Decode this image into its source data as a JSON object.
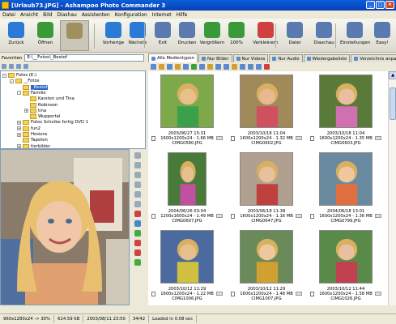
{
  "window": {
    "title": "[Urlaub73.JPG] - Ashampoo Photo Commander 3"
  },
  "menu": [
    "Datei",
    "Ansicht",
    "Bild",
    "Diashau",
    "Assistenten",
    "Konfiguration",
    "Internet",
    "Hilfe"
  ],
  "toolbar": [
    {
      "label": "Zurück",
      "icon": "back-arrow-icon",
      "color": "#2a7ad6"
    },
    {
      "label": "Öffnen",
      "icon": "open-icon",
      "color": "#3a9a3a"
    },
    {
      "label": "",
      "icon": "album-icon",
      "color": "#a09060"
    },
    {
      "label": "Vorherige",
      "icon": "prev-icon",
      "color": "#2a7ad6"
    },
    {
      "label": "Nächste",
      "icon": "next-icon",
      "color": "#2a7ad6"
    },
    {
      "label": "Exit",
      "icon": "exit-icon",
      "color": "#5a7ab0"
    },
    {
      "label": "Drucken",
      "icon": "print-icon",
      "color": "#5a7ab0"
    },
    {
      "label": "Vergrößern",
      "icon": "zoom-in-icon",
      "color": "#3a9a3a"
    },
    {
      "label": "100%",
      "icon": "zoom-100-icon",
      "color": "#3a9a3a"
    },
    {
      "label": "Verkleinern",
      "icon": "zoom-out-icon",
      "color": "#d04040"
    },
    {
      "label": "Datei",
      "icon": "file-icon",
      "color": "#5a7ab0"
    },
    {
      "label": "Diaschau",
      "icon": "slideshow-icon",
      "color": "#5a7ab0"
    },
    {
      "label": "Einstellungen",
      "icon": "settings-icon",
      "color": "#5a7ab0"
    },
    {
      "label": "Easy!",
      "icon": "easy-icon",
      "color": "#5a7ab0"
    }
  ],
  "folderbar": {
    "favorites_label": "Favoriten",
    "path": "E:\\__Fotos\\_Bestof"
  },
  "tabs": [
    {
      "label": "Alle Medientypen",
      "active": true
    },
    {
      "label": "Nur Bilder",
      "active": false
    },
    {
      "label": "Nur Videos",
      "active": false
    },
    {
      "label": "Nur Audio",
      "active": false
    },
    {
      "label": "Wiedergabeliste",
      "active": false
    },
    {
      "label": "Verzeichnis anpassen",
      "active": false
    }
  ],
  "tree": [
    {
      "label": "Fotos (E:)",
      "level": 0,
      "expand": "-"
    },
    {
      "label": "__Fotos",
      "level": 1,
      "expand": "-"
    },
    {
      "label": "_Bestof",
      "level": 2,
      "expand": "",
      "selected": true
    },
    {
      "label": "Familie",
      "level": 2,
      "expand": "-"
    },
    {
      "label": "Karsten und Tina",
      "level": 3,
      "expand": ""
    },
    {
      "label": "Robinson",
      "level": 3,
      "expand": ""
    },
    {
      "label": "tina",
      "level": 3,
      "expand": "+"
    },
    {
      "label": "Wuppertal",
      "level": 3,
      "expand": ""
    },
    {
      "label": "Fotos Scheibe fertig DVD 1",
      "level": 2,
      "expand": "+"
    },
    {
      "label": "fun2",
      "level": 2,
      "expand": "+"
    },
    {
      "label": "Hesiera",
      "level": 2,
      "expand": "+"
    },
    {
      "label": "Tapeten",
      "level": 2,
      "expand": ""
    },
    {
      "label": "tierbilder",
      "level": 2,
      "expand": "+"
    }
  ],
  "thumbnails": [
    {
      "date": "2003/06/27 15:31",
      "dims": "1600x1200x24 - 1.66 MB",
      "file": "CIMG0580.JPG",
      "bg": "#7da94a",
      "fg": "#e8c08a",
      "shirt": "#3aa04a"
    },
    {
      "date": "2003/10/18 11:04",
      "dims": "1600x1200x24 - 1.32 MB",
      "file": "CIMG0602.JPG",
      "bg": "#a08a5a",
      "fg": "#e8b890",
      "shirt": "#d05060"
    },
    {
      "date": "2003/10/18 11:04",
      "dims": "1600x1200x24 - 1.35 MB",
      "file": "CIMG0603.JPG",
      "bg": "#5a7a3a",
      "fg": "#e8c0a0",
      "shirt": "#d070b0"
    },
    {
      "date": "2004/06/26 03:04",
      "dims": "1200x1600x24 - 1.49 MB",
      "file": "CIMG0607.JPG",
      "bg": "#4a7a3a",
      "fg": "#e8c090",
      "shirt": "#c050a0"
    },
    {
      "date": "2003/06/18 11:38",
      "dims": "1600x1200x24 - 1.16 MB",
      "file": "CIMG0647.JPG",
      "bg": "#b0a090",
      "fg": "#e8c0a0",
      "shirt": "#c04040"
    },
    {
      "date": "2004/06/18 13:01",
      "dims": "1600x1200x24 - 1.36 MB",
      "file": "CIMG0799.JPG",
      "bg": "#6a8aa0",
      "fg": "#f0c8a0",
      "shirt": "#e07040"
    },
    {
      "date": "2003/10/12 11:29",
      "dims": "1600x1200x24 - 1.22 MB",
      "file": "CIMG1006.JPG",
      "bg": "#4a6aa0",
      "fg": "#e8c090",
      "shirt": "#d0c040"
    },
    {
      "date": "2003/10/12 11:29",
      "dims": "1600x1200x24 - 1.48 MB",
      "file": "CIMG1007.JPG",
      "bg": "#6a8a5a",
      "fg": "#f0c8a0",
      "shirt": "#d0a030"
    },
    {
      "date": "2003/10/12 11:44",
      "dims": "1600x1200x24 - 1.58 MB",
      "file": "CIMG1026.JPG",
      "bg": "#5a8a4a",
      "fg": "#e8c0a0",
      "shirt": "#c04050"
    }
  ],
  "statusbar": {
    "dims": "960x1280x24 -> 30%",
    "size": "614.59 KB",
    "date": "2003/08/11 23:50",
    "count": "34/42",
    "load": "Loaded in 0.08 sec"
  },
  "colors": {
    "titlebar": "#0a5fd8",
    "selection": "#3168c5"
  }
}
